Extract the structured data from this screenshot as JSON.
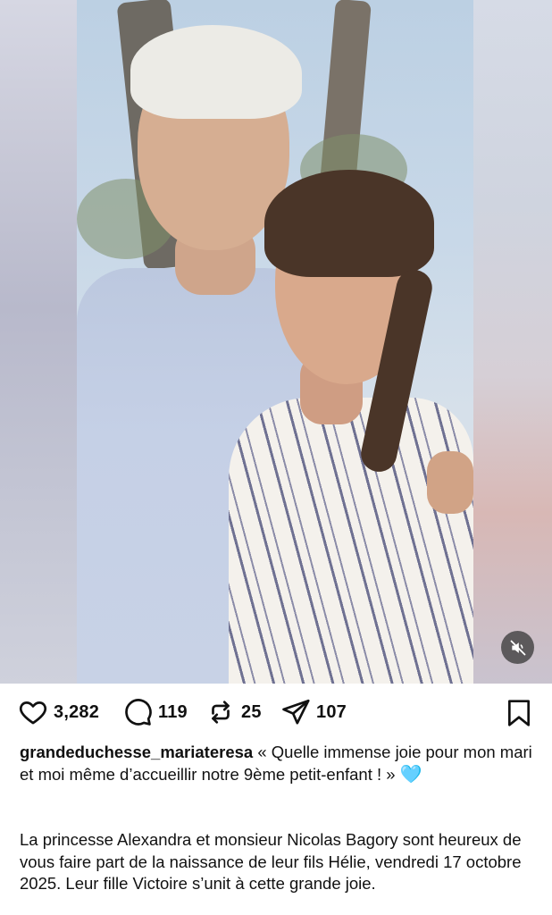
{
  "post": {
    "media": {
      "alt": "",
      "mute_icon": "speaker-muted-icon"
    },
    "actions": {
      "likes": "3,282",
      "comments": "119",
      "reposts": "25",
      "shares": "107"
    },
    "caption": {
      "username": "grandeduchesse_mariateresa",
      "text": " « Quelle immense joie pour mon mari et moi même d’accueillir notre 9ème petit-enfant ! » ",
      "emoji": "🩵"
    },
    "description": "La princesse Alexandra et monsieur Nicolas Bagory sont heureux de vous faire part de la naissance de leur fils Hélie, vendredi 17 octobre 2025. Leur fille Victoire s’unit à cette grande joie."
  },
  "colors": {
    "text": "#111111",
    "heart_emoji": "#7ed2ee",
    "mute_bg": "#3c3c3c"
  }
}
